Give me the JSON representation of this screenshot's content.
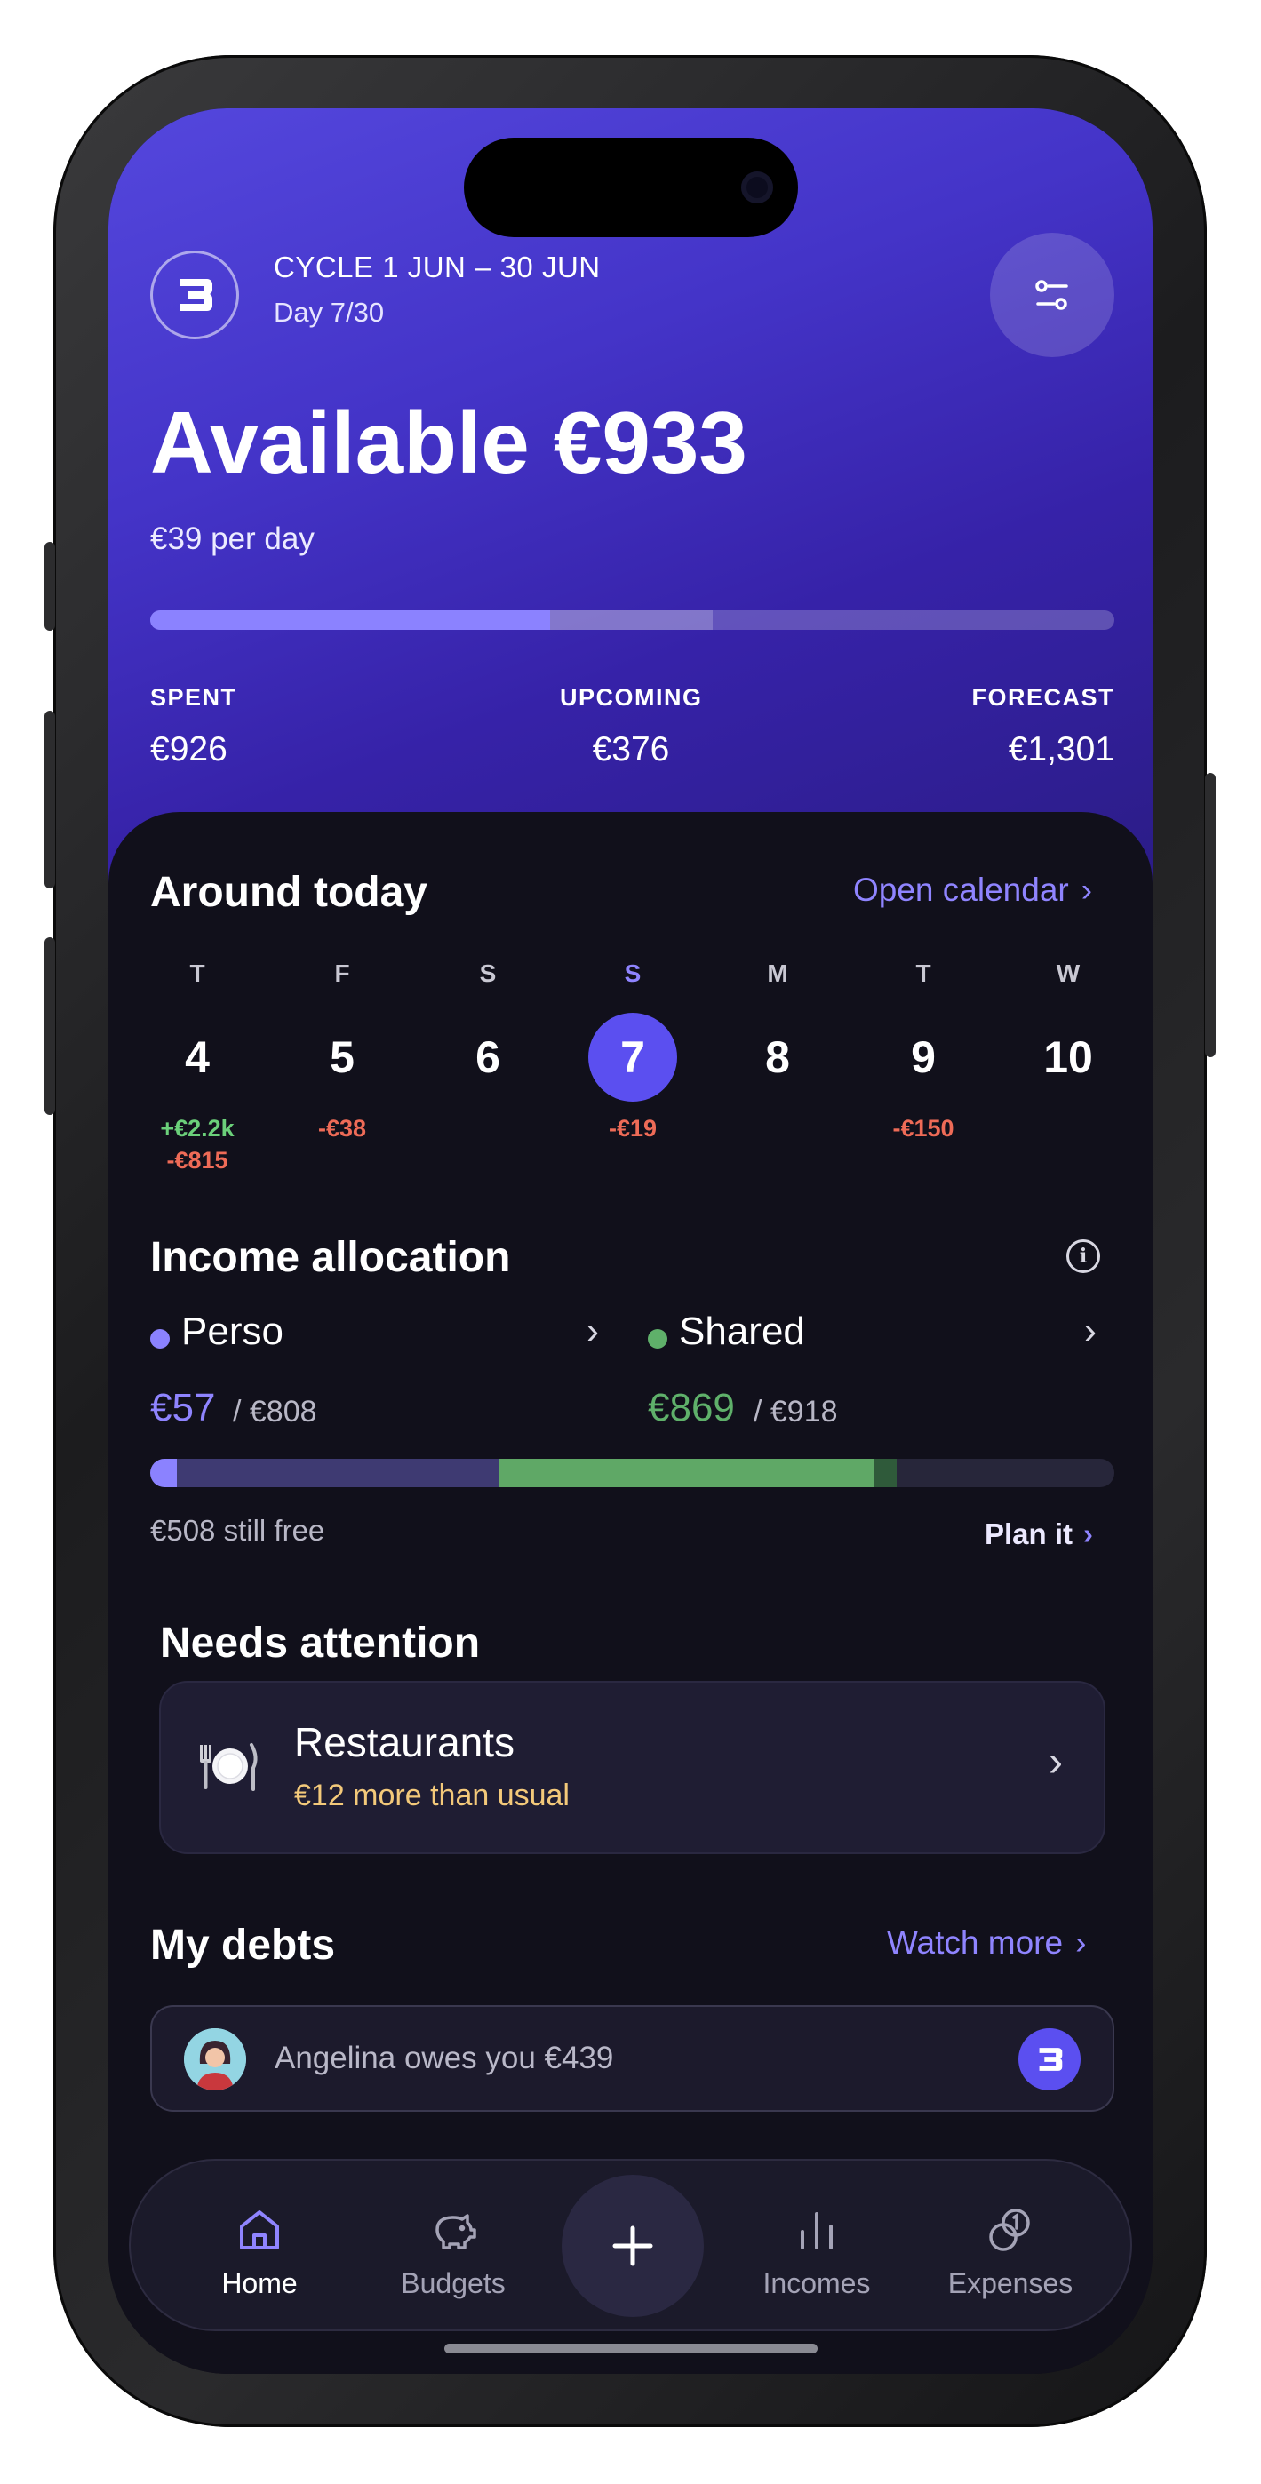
{
  "header": {
    "cycle_label": "CYCLE 1 JUN – 30 JUN",
    "day_label": "Day 7/30",
    "available_label": "Available €933",
    "per_day_label": "€39 per day",
    "progress": {
      "spent_fraction": 0.415,
      "upcoming_fraction": 0.168
    },
    "stats": [
      {
        "label": "SPENT",
        "value": "€926"
      },
      {
        "label": "UPCOMING",
        "value": "€376"
      },
      {
        "label": "FORECAST",
        "value": "€1,301"
      }
    ]
  },
  "around_today": {
    "title": "Around today",
    "link_label": "Open calendar",
    "days": [
      {
        "letter": "T",
        "number": "4",
        "amounts": [
          "+€2.2k",
          "-€815"
        ],
        "today": false
      },
      {
        "letter": "F",
        "number": "5",
        "amounts": [
          "-€38"
        ],
        "today": false
      },
      {
        "letter": "S",
        "number": "6",
        "amounts": [],
        "today": false
      },
      {
        "letter": "S",
        "number": "7",
        "amounts": [
          "-€19"
        ],
        "today": true
      },
      {
        "letter": "M",
        "number": "8",
        "amounts": [],
        "today": false
      },
      {
        "letter": "T",
        "number": "9",
        "amounts": [
          "-€150"
        ],
        "today": false
      },
      {
        "letter": "W",
        "number": "10",
        "amounts": [],
        "today": false
      }
    ]
  },
  "income_allocation": {
    "title": "Income allocation",
    "accounts": [
      {
        "name": "Perso",
        "amount": "€57",
        "total": "/ €808",
        "color": "#8b82ff"
      },
      {
        "name": "Shared",
        "amount": "€869",
        "total": "/ €918",
        "color": "#5fb06a"
      }
    ],
    "still_free_label": "€508 still free",
    "plan_label": "Plan it"
  },
  "needs_attention": {
    "title": "Needs attention",
    "item": {
      "name": "Restaurants",
      "subtitle": "€12 more than usual",
      "icon": "plate-cutlery-icon"
    }
  },
  "debts": {
    "title": "My debts",
    "link_label": "Watch more",
    "items": [
      {
        "text": "Angelina owes you €439"
      }
    ]
  },
  "nav": {
    "items": [
      {
        "label": "Home",
        "icon": "home-icon",
        "active": true
      },
      {
        "label": "Budgets",
        "icon": "piggy-bank-icon",
        "active": false
      },
      {
        "label": "Incomes",
        "icon": "bar-chart-icon",
        "active": false
      },
      {
        "label": "Expenses",
        "icon": "coins-icon",
        "active": false
      }
    ],
    "add_icon": "plus-icon"
  },
  "colors": {
    "accent": "#5b4ff0",
    "header_gradient_start": "#5447dd",
    "header_gradient_end": "#2b1c86",
    "background": "#11101b",
    "positive": "#6bd07a",
    "negative": "#ee6b57",
    "warning_text": "#f3c97a"
  }
}
